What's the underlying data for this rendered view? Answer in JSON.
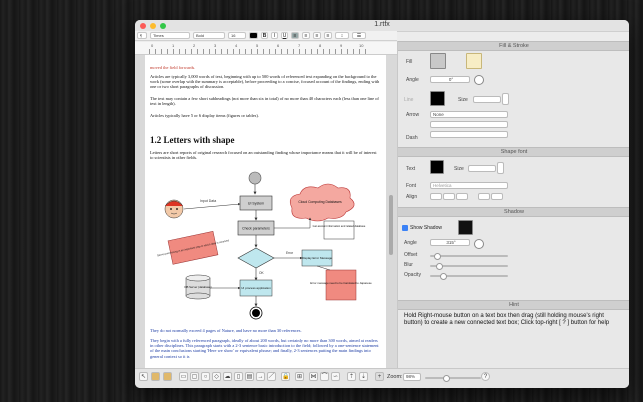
{
  "window": {
    "title": "1.rtfx"
  },
  "format_bar": {
    "style": "¶",
    "font": "Times",
    "weight": "Bold",
    "size": "16",
    "bold": "B",
    "italic": "I",
    "underline": "U"
  },
  "ruler": {
    "labels": [
      "0",
      "1",
      "2",
      "3",
      "4",
      "5",
      "6",
      "7",
      "8",
      "9",
      "10"
    ]
  },
  "document": {
    "p0": "moved the field forwards.",
    "p1": "Articles are typically 3,000 words of text, beginning with up to 500 words of referenced text expanding on the background to the work (some overlap with the summary is acceptable), before proceeding to a concise, focused account of the findings, ending with one or two short paragraphs of discussion.",
    "p2": "The text may contain a few short subheadings (not more than six in total) of no more than 40 characters each (less than one line of text in length).",
    "p3": "Articles typically have 5 or 6 display items (figures or tables).",
    "heading": "1.2 Letters with shape",
    "p4": "Letters are short reports of original research focused on an outstanding finding whose importance means that it will be of interest to scientists in other fields.",
    "p5": "They do not normally exceed 4 pages of Nature, and have no more than 30 references.",
    "p6": "They begin with a fully referenced paragraph, ideally of about 200 words, but certainly no more than 300 words, aimed at readers in other disciplines. This paragraph starts with a 2-3 sentence basic introduction to the field; followed by a one-sentence statement of the main conclusions starting 'Here we show' or equivalent phrase; and finally, 2-3 sentences putting the main findings into general context so it is",
    "diagram": {
      "input_data": "Input Data",
      "ui_system": "UI System",
      "check_parameters": "Check parameters",
      "cloud_db": "Cloud Computing Databases",
      "get_account": "Get account information and related database",
      "error": "Error",
      "display_error": "Display Error Message",
      "ok": "OK",
      "db_server": "DB Server (database)",
      "ui_process": "UI process application",
      "error_translated": "Error message need to be translated to Japanese",
      "note": "Server processing is an important step in which data is received"
    }
  },
  "inspector": {
    "fill_stroke": "Fill & Stroke",
    "fill_label": "Fill",
    "angle_label": "Angle",
    "angle_value": "0°",
    "line_label": "Line",
    "size_label": "Size",
    "arrow_label": "Arrow",
    "arrow_value": "None",
    "dash_label": "Dash",
    "shape_font": "Shape font",
    "text_label": "Text",
    "font_label": "Font",
    "font_value": "Helvetica",
    "align_label": "Align",
    "shadow": "Shadow",
    "show_shadow": "Show Shadow",
    "shadow_angle_label": "Angle",
    "shadow_angle_value": "315°",
    "offset_label": "Offset",
    "blur_label": "Blur",
    "opacity_label": "Opacity",
    "hint_head": "Hint",
    "hint_text": "Hold Right-mouse button on a text box then drag (still holding mouse's right button) to create a new connected text box;  Click top-right [ ? ] button for help"
  },
  "bottom_bar": {
    "zoom_label": "Zoom:",
    "zoom_value": "98%",
    "help": "?"
  },
  "colors": {
    "red_text": "#c0392b",
    "blue_text": "#1a3aa3",
    "fill_swatch": "#c8c8c8",
    "line_swatch": "#000000",
    "shadow_swatch": "#111111"
  }
}
